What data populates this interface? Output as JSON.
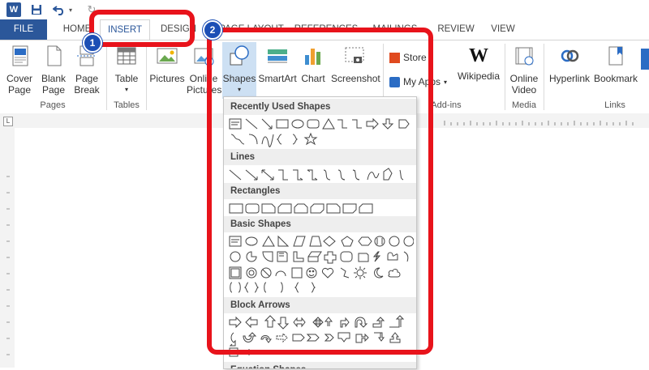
{
  "qat": {
    "icons": [
      "word-icon",
      "save-icon",
      "undo-icon",
      "undo-dropdown-icon",
      "redo-icon"
    ]
  },
  "tabs": [
    "FILE",
    "HOME",
    "INSERT",
    "DESIGN",
    "PAGE LAYOUT",
    "REFERENCES",
    "MAILINGS",
    "REVIEW",
    "VIEW"
  ],
  "ribbon": {
    "cover_page": "Cover Page",
    "blank_page": "Blank Page",
    "page_break": "Page Break",
    "pages_group": "Pages",
    "table": "Table",
    "tables_group": "Tables",
    "pictures": "Pictures",
    "online_pictures": "Online Pictures",
    "shapes": "Shapes",
    "smartart": "SmartArt",
    "chart": "Chart",
    "screenshot": "Screenshot",
    "store": "Store",
    "my_apps": "My Apps",
    "wikipedia": "Wikipedia",
    "addins_group": "Add-ins",
    "online_video": "Online Video",
    "media_group": "Media",
    "hyperlink": "Hyperlink",
    "bookmark": "Bookmark",
    "links_group": "Links"
  },
  "shapes_menu": {
    "recently_used": "Recently Used Shapes",
    "lines": "Lines",
    "rectangles": "Rectangles",
    "basic_shapes": "Basic Shapes",
    "block_arrows": "Block Arrows",
    "equation_shapes": "Equation Shapes"
  },
  "badges": {
    "one": "1",
    "two": "2"
  },
  "colors": {
    "accent": "#2b579a",
    "highlight": "#e8131b",
    "badge": "#1c4fb5"
  }
}
